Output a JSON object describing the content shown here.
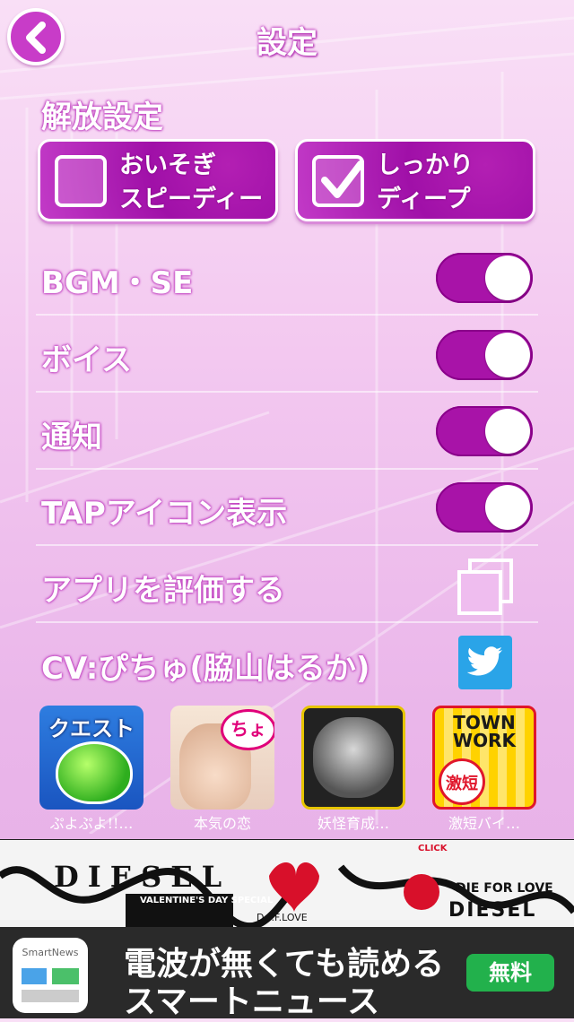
{
  "header": {
    "title": "設定"
  },
  "release": {
    "section_label": "解放設定",
    "quick": {
      "line1": "おいそぎ",
      "line2": "スピーディー",
      "checked": false
    },
    "deep": {
      "line1": "しっかり",
      "line2": "ディープ",
      "checked": true
    }
  },
  "settings": {
    "bgm": {
      "label": "BGM・SE",
      "on": true
    },
    "voice": {
      "label": "ボイス",
      "on": true
    },
    "notify": {
      "label": "通知",
      "on": true
    },
    "tap_icon": {
      "label": "TAPアイコン表示",
      "on": true
    },
    "rate": {
      "label": "アプリを評価する",
      "icon": "copy-icon"
    },
    "cv": {
      "label": "CV:ぴちゅ(脇山はるか)",
      "icon": "twitter-icon"
    }
  },
  "apps": [
    {
      "name": "ぷよぷよ!!…",
      "icon_text": "クエスト"
    },
    {
      "name": "本気の恋",
      "icon_text": "ちょ"
    },
    {
      "name": "妖怪育成…",
      "icon_text": ""
    },
    {
      "name": "激短バイ…",
      "icon_text": "TOWN WORK",
      "badge": "激短"
    }
  ],
  "ads": {
    "diesel": {
      "brand_left": "DIESEL",
      "sub": "VALENTINE'S DAY SPECIAL",
      "love": "D.F.F.LOVE",
      "click": "CLICK",
      "tagline": "DIE FOR LOVE",
      "brand_right": "DIESEL"
    },
    "smartnews": {
      "app_label": "SmartNews",
      "line1": "電波が無くても読める",
      "line2": "スマートニュース",
      "cta": "無料"
    }
  },
  "colors": {
    "accent": "#a813a8",
    "twitter": "#2aa4e8",
    "cta": "#22b14c"
  }
}
